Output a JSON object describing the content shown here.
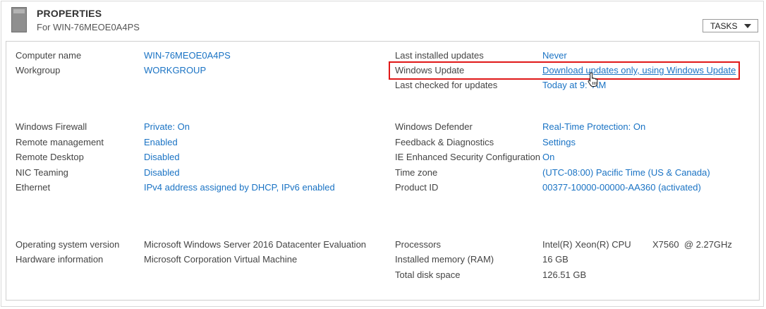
{
  "header": {
    "title": "PROPERTIES",
    "subtitle": "For WIN-76MEOE0A4PS",
    "tasks_label": "TASKS",
    "icon": "server-icon"
  },
  "colors": {
    "link": "#1a73c4",
    "label": "#444444",
    "highlight": "#e01818"
  },
  "left": {
    "computer_name": {
      "label": "Computer name",
      "value": "WIN-76MEOE0A4PS"
    },
    "workgroup": {
      "label": "Workgroup",
      "value": "WORKGROUP"
    },
    "firewall": {
      "label": "Windows Firewall",
      "value": "Private: On"
    },
    "remote_mgmt": {
      "label": "Remote management",
      "value": "Enabled"
    },
    "remote_desktop": {
      "label": "Remote Desktop",
      "value": "Disabled"
    },
    "nic_teaming": {
      "label": "NIC Teaming",
      "value": "Disabled"
    },
    "ethernet": {
      "label": "Ethernet",
      "value": "IPv4 address assigned by DHCP, IPv6 enabled"
    },
    "os_version": {
      "label": "Operating system version",
      "value": "Microsoft Windows Server 2016 Datacenter Evaluation"
    },
    "hardware": {
      "label": "Hardware information",
      "value": "Microsoft Corporation Virtual Machine"
    }
  },
  "right": {
    "last_installed": {
      "label": "Last installed updates",
      "value": "Never"
    },
    "windows_update": {
      "label": "Windows Update",
      "value": "Download updates only, using Windows Update"
    },
    "last_checked": {
      "label": "Last checked for updates",
      "value": "Today at 9:  AM"
    },
    "defender": {
      "label": "Windows Defender",
      "value": "Real-Time Protection: On"
    },
    "feedback": {
      "label": "Feedback & Diagnostics",
      "value": "Settings"
    },
    "ie_esc": {
      "label": "IE Enhanced Security Configuration",
      "value": "On"
    },
    "timezone": {
      "label": "Time zone",
      "value": "(UTC-08:00) Pacific Time (US & Canada)"
    },
    "product_id": {
      "label": "Product ID",
      "value": "00377-10000-00000-AA360 (activated)"
    },
    "processors": {
      "label": "Processors",
      "value": "Intel(R) Xeon(R) CPU",
      "value2": "X7560  @ 2.27GHz"
    },
    "memory": {
      "label": "Installed memory (RAM)",
      "value": "16 GB"
    },
    "disk": {
      "label": "Total disk space",
      "value": "126.51 GB"
    }
  }
}
